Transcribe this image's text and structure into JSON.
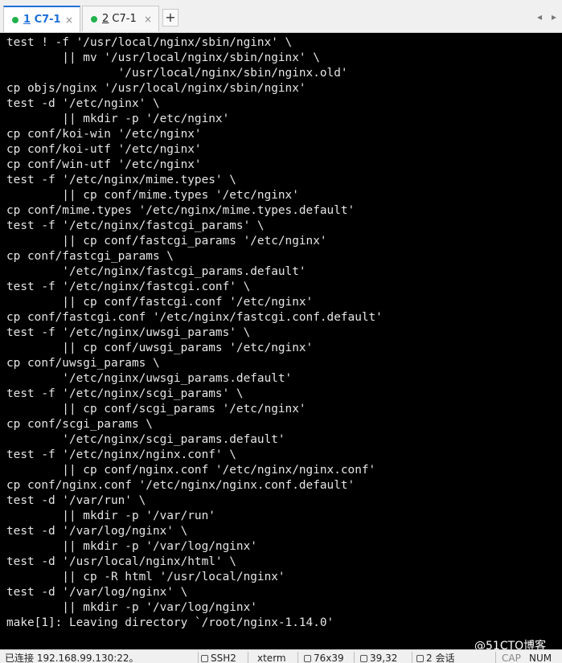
{
  "tabs": [
    {
      "index": "1",
      "label": " C7-1",
      "active": true
    },
    {
      "index": "2",
      "label": " C7-1",
      "active": false
    }
  ],
  "tab_close_glyph": "×",
  "add_tab_glyph": "+",
  "tab_nav_left": "◂",
  "tab_nav_right": "▸",
  "terminal": {
    "lines": [
      "test ! -f '/usr/local/nginx/sbin/nginx' \\",
      "        || mv '/usr/local/nginx/sbin/nginx' \\",
      "                '/usr/local/nginx/sbin/nginx.old'",
      "cp objs/nginx '/usr/local/nginx/sbin/nginx'",
      "test -d '/etc/nginx' \\",
      "        || mkdir -p '/etc/nginx'",
      "cp conf/koi-win '/etc/nginx'",
      "cp conf/koi-utf '/etc/nginx'",
      "cp conf/win-utf '/etc/nginx'",
      "test -f '/etc/nginx/mime.types' \\",
      "        || cp conf/mime.types '/etc/nginx'",
      "cp conf/mime.types '/etc/nginx/mime.types.default'",
      "test -f '/etc/nginx/fastcgi_params' \\",
      "        || cp conf/fastcgi_params '/etc/nginx'",
      "cp conf/fastcgi_params \\",
      "        '/etc/nginx/fastcgi_params.default'",
      "test -f '/etc/nginx/fastcgi.conf' \\",
      "        || cp conf/fastcgi.conf '/etc/nginx'",
      "cp conf/fastcgi.conf '/etc/nginx/fastcgi.conf.default'",
      "test -f '/etc/nginx/uwsgi_params' \\",
      "        || cp conf/uwsgi_params '/etc/nginx'",
      "cp conf/uwsgi_params \\",
      "        '/etc/nginx/uwsgi_params.default'",
      "test -f '/etc/nginx/scgi_params' \\",
      "        || cp conf/scgi_params '/etc/nginx'",
      "cp conf/scgi_params \\",
      "        '/etc/nginx/scgi_params.default'",
      "test -f '/etc/nginx/nginx.conf' \\",
      "        || cp conf/nginx.conf '/etc/nginx/nginx.conf'",
      "cp conf/nginx.conf '/etc/nginx/nginx.conf.default'",
      "test -d '/var/run' \\",
      "        || mkdir -p '/var/run'",
      "test -d '/var/log/nginx' \\",
      "        || mkdir -p '/var/log/nginx'",
      "test -d '/usr/local/nginx/html' \\",
      "        || cp -R html '/usr/local/nginx'",
      "test -d '/var/log/nginx' \\",
      "        || mkdir -p '/var/log/nginx'",
      "make[1]: Leaving directory `/root/nginx-1.14.0'"
    ]
  },
  "statusbar": {
    "connection": "已连接 192.168.99.130:22。",
    "protocol": "SSH2",
    "terminal_type": "xterm",
    "size": "76x39",
    "cursor": "39,32",
    "sessions": "2 会话",
    "caps": "CAP",
    "num": "NUM"
  },
  "watermark": "@51CTO博客"
}
